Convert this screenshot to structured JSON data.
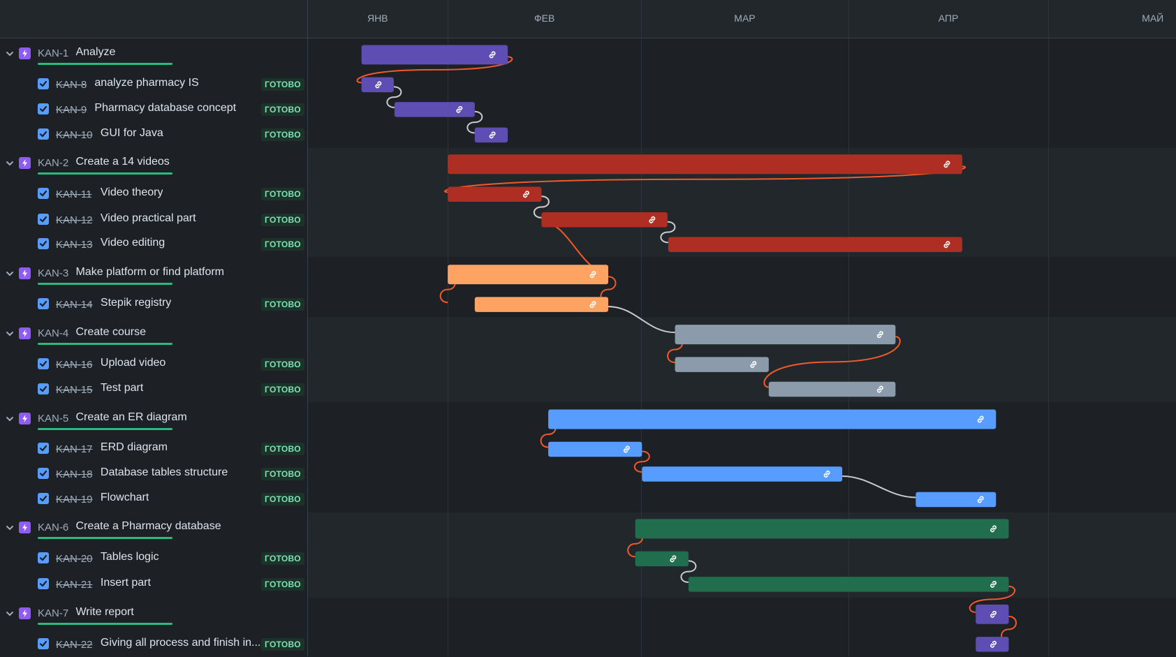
{
  "timeline": {
    "months": [
      "ЯНВ",
      "ФЕВ",
      "МАР",
      "АПР",
      "МАЙ"
    ]
  },
  "status_label": "ГОТОВО",
  "colors": {
    "background": "#1d2125",
    "band": "#22272b",
    "accent_progress": "#2abb7f",
    "badge_bg": "#1c3329",
    "badge_text": "#7ee2b8",
    "dependency_line": "#f15a2b",
    "dependency_line_alt": "#c8ccd0",
    "epic_icon": "#8f5cf2",
    "checkbox": "#579dff"
  },
  "epics": [
    {
      "key": "KAN-1",
      "title": "Analyze",
      "color": "#5e4db2",
      "tasks": [
        {
          "key": "KAN-8",
          "title": "analyze pharmacy IS"
        },
        {
          "key": "KAN-9",
          "title": "Pharmacy database concept"
        },
        {
          "key": "KAN-10",
          "title": "GUI for Java"
        }
      ]
    },
    {
      "key": "KAN-2",
      "title": "Create a 14 videos",
      "color": "#ae2e24",
      "tasks": [
        {
          "key": "KAN-11",
          "title": "Video theory"
        },
        {
          "key": "KAN-12",
          "title": "Video practical part"
        },
        {
          "key": "KAN-13",
          "title": "Video editing"
        }
      ]
    },
    {
      "key": "KAN-3",
      "title": "Make platform or find platform",
      "color": "#fea362",
      "tasks": [
        {
          "key": "KAN-14",
          "title": "Stepik registry"
        }
      ]
    },
    {
      "key": "KAN-4",
      "title": "Create course",
      "color": "#8c9bab",
      "tasks": [
        {
          "key": "KAN-16",
          "title": "Upload video"
        },
        {
          "key": "KAN-15",
          "title": "Test part"
        }
      ]
    },
    {
      "key": "KAN-5",
      "title": "Create an ER diagram",
      "color": "#579dff",
      "tasks": [
        {
          "key": "KAN-17",
          "title": "ERD diagram"
        },
        {
          "key": "KAN-18",
          "title": "Database tables structure"
        },
        {
          "key": "KAN-19",
          "title": "Flowchart"
        }
      ]
    },
    {
      "key": "KAN-6",
      "title": "Create a Pharmacy database",
      "color": "#216e4e",
      "tasks": [
        {
          "key": "KAN-20",
          "title": "Tables logic"
        },
        {
          "key": "KAN-21",
          "title": "Insert part"
        }
      ]
    },
    {
      "key": "KAN-7",
      "title": "Write report",
      "color": "#5e4db2",
      "tasks": [
        {
          "key": "KAN-22",
          "title": "Giving all process and finish in..."
        }
      ]
    }
  ]
}
